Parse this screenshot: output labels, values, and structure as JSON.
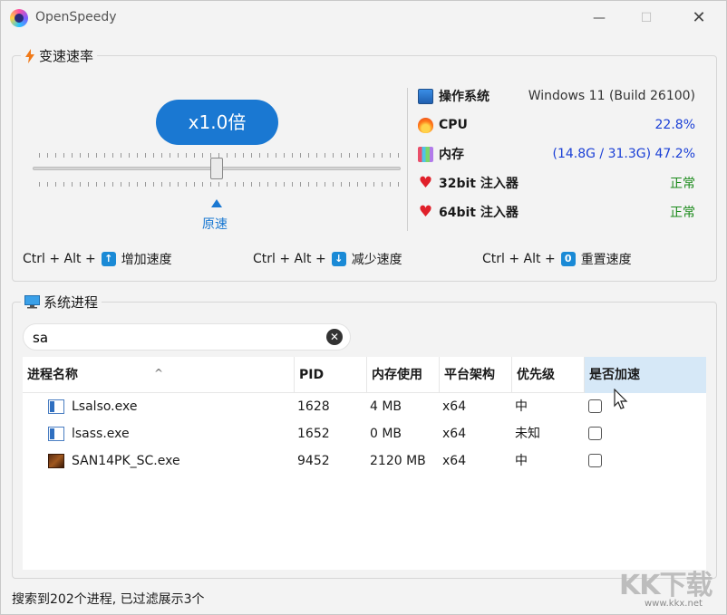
{
  "window": {
    "title": "OpenSpeedy",
    "min_icon": "—",
    "max_icon": "☐",
    "close_icon": "✕"
  },
  "speed_group": {
    "legend": "变速速率",
    "current_speed": "x1.0倍",
    "slider_value": 0.5,
    "origin_label": "原速"
  },
  "stats": [
    {
      "icon": "monitor-icon",
      "label": "操作系统",
      "value": "Windows 11 (Build 26100)",
      "color": "#333333"
    },
    {
      "icon": "flame-icon",
      "label": "CPU",
      "value": "22.8%",
      "color": "#1a3fd6"
    },
    {
      "icon": "memory-icon",
      "label": "内存",
      "value": "(14.8G / 31.3G) 47.2%",
      "color": "#1a3fd6"
    },
    {
      "icon": "heart-icon",
      "label": "32bit 注入器",
      "value": "正常",
      "color": "#1a8a1a"
    },
    {
      "icon": "heart-icon",
      "label": "64bit 注入器",
      "value": "正常",
      "color": "#1a8a1a"
    }
  ],
  "hotkeys": [
    {
      "combo": "Ctrl + Alt +",
      "key": "↑",
      "label": "增加速度"
    },
    {
      "combo": "Ctrl + Alt +",
      "key": "↓",
      "label": "减少速度"
    },
    {
      "combo": "Ctrl + Alt +",
      "key": "0",
      "label": "重置速度"
    }
  ],
  "process_group": {
    "legend": "系统进程",
    "search_value": "sa",
    "clear_icon": "✕",
    "columns": [
      "进程名称",
      "PID",
      "内存使用",
      "平台架构",
      "优先级",
      "是否加速"
    ],
    "rows": [
      {
        "name": "Lsalso.exe",
        "pid": "1628",
        "mem": "4 MB",
        "arch": "x64",
        "priority": "中",
        "accelerated": false
      },
      {
        "name": "lsass.exe",
        "pid": "1652",
        "mem": "0 MB",
        "arch": "x64",
        "priority": "未知",
        "accelerated": false
      },
      {
        "name": "SAN14PK_SC.exe",
        "pid": "9452",
        "mem": "2120 MB",
        "arch": "x64",
        "priority": "中",
        "accelerated": false
      }
    ]
  },
  "status": "搜索到202个进程, 已过滤展示3个",
  "watermark": {
    "big": "KK下载",
    "small": "www.kkx.net"
  },
  "colors": {
    "accent": "#1a78d2",
    "selected_header": "#d6e8f7"
  }
}
